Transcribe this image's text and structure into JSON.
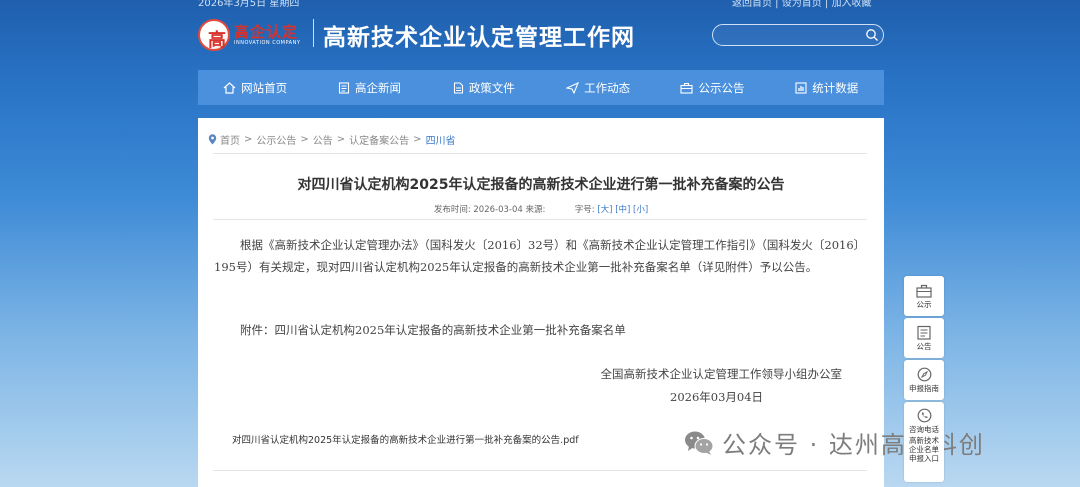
{
  "topbar": {
    "left_text": "2026年3月5日 星期四",
    "right_text": "返回首页 | 设为首页 | 加入收藏"
  },
  "header": {
    "logo_name": "高企认定",
    "logo_sub": "INNOVATION COMPANY",
    "site_title": "高新技术企业认定管理工作网",
    "search_placeholder": ""
  },
  "nav": [
    {
      "label": "网站首页",
      "icon": "home-icon"
    },
    {
      "label": "高企新闻",
      "icon": "news-icon"
    },
    {
      "label": "政策文件",
      "icon": "document-icon"
    },
    {
      "label": "工作动态",
      "icon": "send-icon"
    },
    {
      "label": "公示公告",
      "icon": "briefcase-icon"
    },
    {
      "label": "统计数据",
      "icon": "chart-icon"
    }
  ],
  "breadcrumb": [
    "首页",
    ">",
    "公示公告",
    ">",
    "公告",
    ">",
    "认定备案公告",
    ">",
    "四川省"
  ],
  "article": {
    "title": "对四川省认定机构2025年认定报备的高新技术企业进行第一批补充备案的公告",
    "published_label": "发布时间:",
    "published_value": "2026-03-04",
    "source_label": "来源:",
    "source_value": "",
    "fontsize_label": "字号:",
    "fontsize_large": "[大]",
    "fontsize_medium": "[中]",
    "fontsize_small": "[小]",
    "body": "根据《高新技术企业认定管理办法》（国科发火〔2016〕32号）和《高新技术企业认定管理工作指引》（国科发火〔2016〕195号）有关规定，现对四川省认定机构2025年认定报备的高新技术企业第一批补充备案名单（详见附件）予以公告。",
    "attachment": "附件：四川省认定机构2025年认定报备的高新技术企业第一批补充备案名单",
    "signer": "全国高新技术企业认定管理工作领导小组办公室",
    "sign_date": "2026年03月04日",
    "pdf_link": "对四川省认定机构2025年认定报备的高新技术企业进行第一批补充备案的公告.pdf"
  },
  "watermark": "公众号 · 达州高新科创",
  "dock": [
    {
      "label": "公示",
      "icon": "briefcase-icon"
    },
    {
      "label": "公告",
      "icon": "notice-icon"
    },
    {
      "label": "申报指南",
      "icon": "compass-icon"
    },
    {
      "label": "咨询电话",
      "icon": "phone-icon"
    },
    {
      "label": "高新技术企业名单申报入口",
      "icon": "entry-icon"
    }
  ]
}
